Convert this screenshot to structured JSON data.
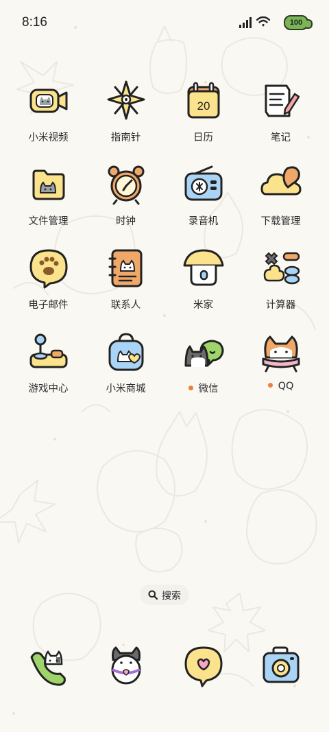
{
  "status": {
    "time": "8:16",
    "battery": "100"
  },
  "apps": [
    {
      "label": "小米视频",
      "icon": "video-camera-cat-icon",
      "dot": false
    },
    {
      "label": "指南针",
      "icon": "compass-star-icon",
      "dot": false
    },
    {
      "label": "日历",
      "icon": "calendar-icon",
      "dot": false,
      "calendar_day": "20"
    },
    {
      "label": "笔记",
      "icon": "notes-pencil-icon",
      "dot": false
    },
    {
      "label": "文件管理",
      "icon": "folder-cat-icon",
      "dot": false
    },
    {
      "label": "时钟",
      "icon": "alarm-clock-icon",
      "dot": false
    },
    {
      "label": "录音机",
      "icon": "radio-recorder-icon",
      "dot": false
    },
    {
      "label": "下载管理",
      "icon": "cloud-download-icon",
      "dot": false
    },
    {
      "label": "电子邮件",
      "icon": "paw-bubble-icon",
      "dot": false
    },
    {
      "label": "联系人",
      "icon": "contacts-book-icon",
      "dot": false
    },
    {
      "label": "米家",
      "icon": "mushroom-house-icon",
      "dot": false
    },
    {
      "label": "计算器",
      "icon": "calculator-symbols-icon",
      "dot": false
    },
    {
      "label": "游戏中心",
      "icon": "joystick-icon",
      "dot": false
    },
    {
      "label": "小米商城",
      "icon": "shopping-bag-icon",
      "dot": false
    },
    {
      "label": "微信",
      "icon": "wechat-cat-icon",
      "dot": true
    },
    {
      "label": "QQ",
      "icon": "qq-cat-scarf-icon",
      "dot": true
    }
  ],
  "search": {
    "label": "搜索"
  },
  "dock": [
    {
      "icon": "phone-cat-icon"
    },
    {
      "icon": "messages-cat-ball-icon"
    },
    {
      "icon": "heart-bubble-icon"
    },
    {
      "icon": "camera-icon"
    }
  ],
  "colors": {
    "background": "#faf8f3",
    "accent_dot": "#e8823e",
    "icon_yellow": "#fbe28c",
    "icon_blue": "#a9d4f5",
    "icon_orange": "#f0a868",
    "battery_green": "#7ab457"
  }
}
